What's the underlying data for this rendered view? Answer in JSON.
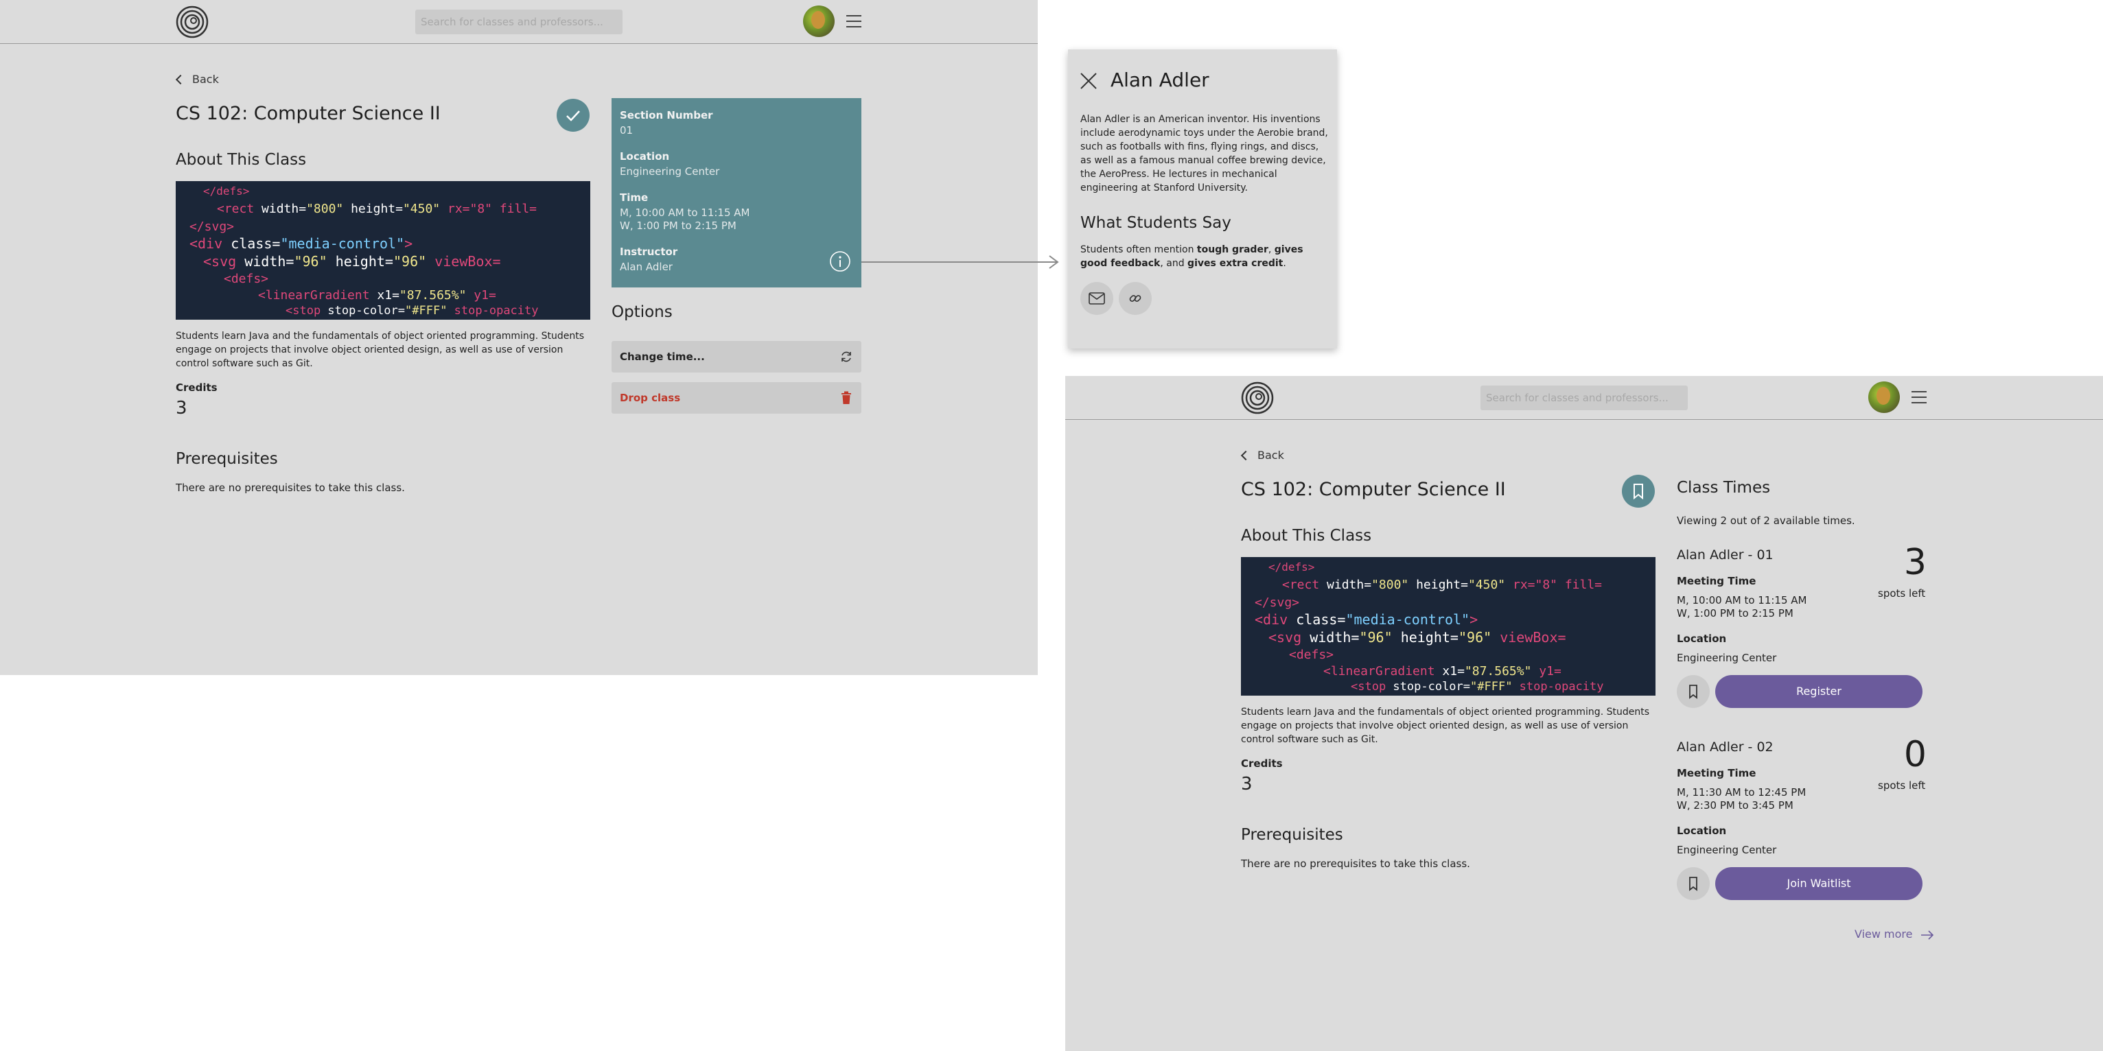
{
  "app": {
    "search_placeholder": "Search for classes and professors..."
  },
  "screen_left": {
    "back_label": "Back",
    "course_title": "CS 102: Computer Science II",
    "about_heading": "About This Class",
    "description": "Students learn Java and the fundamentals of object oriented programming. Students engage on projects that involve object oriented design, as well as use of version control software such as Git.",
    "credits_label": "Credits",
    "credits_value": "3",
    "prereq_heading": "Prerequisites",
    "prereq_text": "There are no prerequisites to take this class.",
    "enrolled_card": {
      "section_label": "Section Number",
      "section_value": "01",
      "location_label": "Location",
      "location_value": "Engineering Center",
      "time_label": "Time",
      "time_line1": "M, 10:00 AM to 11:15 AM",
      "time_line2": "W, 1:00 PM to 2:15 PM",
      "instructor_label": "Instructor",
      "instructor_value": "Alan Adler"
    },
    "options_heading": "Options",
    "change_time_label": "Change time...",
    "drop_class_label": "Drop class"
  },
  "instructor_popup": {
    "name": "Alan Adler",
    "bio": "Alan Adler is an American inventor. His inventions include aerodynamic toys under the Aerobie brand, such as footballs with fins, flying rings, and discs, as well as a famous manual coffee brewing device, the AeroPress. He lectures in mechanical engineering at Stanford University.",
    "students_heading": "What Students Say",
    "students_prefix": "Students often mention ",
    "tag1": "tough grader",
    "sep1": ", ",
    "tag2": "gives good feedback",
    "sep2": ", and ",
    "tag3": "gives extra credit",
    "suffix": "."
  },
  "screen_right": {
    "back_label": "Back",
    "course_title": "CS 102: Computer Science II",
    "about_heading": "About This Class",
    "description": "Students learn Java and the fundamentals of object oriented programming. Students engage on projects that involve object oriented design, as well as use of version control software such as Git.",
    "credits_label": "Credits",
    "credits_value": "3",
    "prereq_heading": "Prerequisites",
    "prereq_text": "There are no prerequisites to take this class.",
    "class_times_heading": "Class Times",
    "viewing_text": "Viewing 2 out of 2 available times.",
    "sections": [
      {
        "name": "Alan Adler - 01",
        "meeting_label": "Meeting Time",
        "meeting_line1": "M, 10:00 AM to 11:15 AM",
        "meeting_line2": "W, 1:00 PM to 2:15 PM",
        "location_label": "Location",
        "location_value": "Engineering Center",
        "spots": "3",
        "spots_label": "spots left",
        "action_label": "Register"
      },
      {
        "name": "Alan Adler - 02",
        "meeting_label": "Meeting Time",
        "meeting_line1": "M, 11:30 AM to 12:45 PM",
        "meeting_line2": "W, 2:30 PM to 3:45 PM",
        "location_label": "Location",
        "location_value": "Engineering Center",
        "spots": "0",
        "spots_label": "spots left",
        "action_label": "Join Waitlist"
      }
    ],
    "view_more_label": "View more"
  },
  "colors": {
    "panel_bg": "#dcdcdc",
    "teal": "#5b8a91",
    "purple": "#6b5b9c",
    "drop_red": "#c0392b"
  }
}
